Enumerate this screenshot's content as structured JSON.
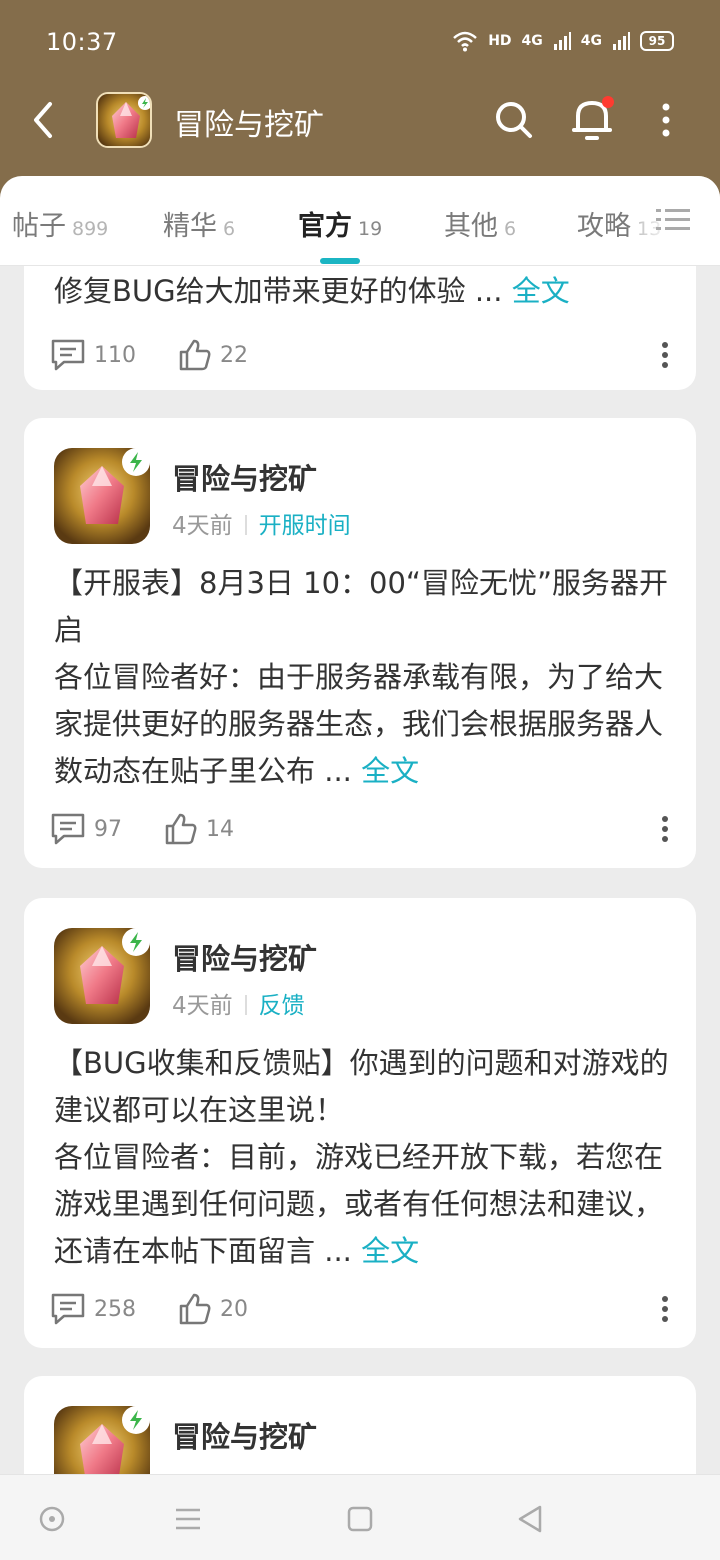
{
  "status_bar": {
    "time": "10:37",
    "network": "HD",
    "signal_1": "4G",
    "signal_2": "4G",
    "battery": "95"
  },
  "nav": {
    "title": "冒险与挖矿"
  },
  "tabs": [
    {
      "label": "帖子",
      "count": "899"
    },
    {
      "label": "精华",
      "count": "6"
    },
    {
      "label": "官方",
      "count": "19"
    },
    {
      "label": "其他",
      "count": "6"
    },
    {
      "label": "攻略",
      "count": "13"
    }
  ],
  "posts": [
    {
      "excerpt_tail": "修复BUG给大加带来更好的体验",
      "ellipsis": "...",
      "more_label": "全文",
      "comments": "110",
      "likes": "22"
    },
    {
      "author": "冒险与挖矿",
      "time": "4天前",
      "tag": "开服时间",
      "title": "【开服表】8月3日 10：00“冒险无忧”服务器开启",
      "excerpt": "各位冒险者好：由于服务器承载有限，为了给大家提供更好的服务器生态，我们会根据服务器人数动态在贴子里公布",
      "ellipsis": "...",
      "more_label": "全文",
      "comments": "97",
      "likes": "14"
    },
    {
      "author": "冒险与挖矿",
      "time": "4天前",
      "tag": "反馈",
      "title": "【BUG收集和反馈贴】你遇到的问题和对游戏的建议都可以在这里说！",
      "excerpt": "各位冒险者：目前，游戏已经开放下载，若您在游戏里遇到任何问题，或者有任何想法和建议，还请在本帖下面留言",
      "ellipsis": "...",
      "more_label": "全文",
      "comments": "258",
      "likes": "20"
    },
    {
      "author": "冒险与挖矿"
    }
  ],
  "colors": {
    "header_bg": "#846d4b",
    "accent": "#1bb5c3",
    "notification_dot": "#ff3b30"
  }
}
